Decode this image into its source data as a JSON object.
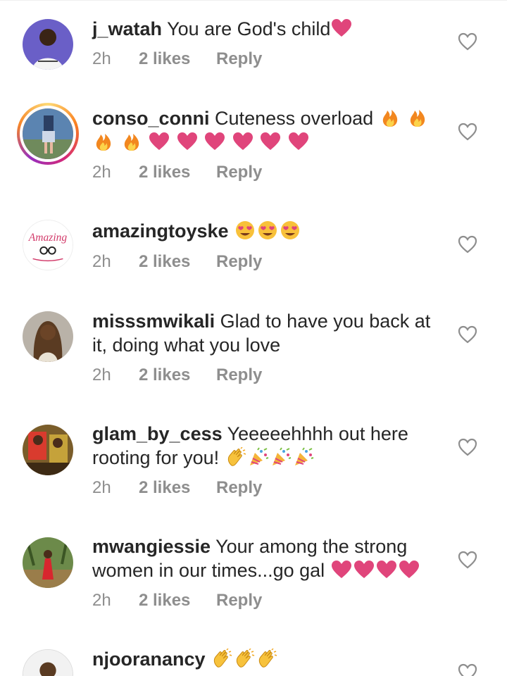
{
  "comments": [
    {
      "username": "j_watah",
      "lines": [
        "You are God's  child"
      ],
      "emoji_lines": [
        [
          "pink-heart"
        ]
      ],
      "time": "2h",
      "likes": "2 likes",
      "reply": "Reply"
    },
    {
      "username": "conso_conni",
      "lines": [
        "Cuteness overload"
      ],
      "emoji_lines": [
        [
          "fire",
          "fire"
        ],
        [
          "fire",
          "fire",
          "pink-heart",
          "pink-heart",
          "pink-heart",
          "pink-heart",
          "pink-heart",
          "pink-heart"
        ]
      ],
      "time": "2h",
      "likes": "2 likes",
      "reply": "Reply"
    },
    {
      "username": "amazingtoyske",
      "lines": [
        ""
      ],
      "emoji_lines": [
        [
          "heart-eyes",
          "heart-eyes",
          "heart-eyes"
        ]
      ],
      "time": "2h",
      "likes": "2 likes",
      "reply": "Reply",
      "avatar_text": "Amazing"
    },
    {
      "username": "misssmwikali",
      "lines": [
        "Glad to have you back at",
        "it, doing what you love"
      ],
      "time": "2h",
      "likes": "2 likes",
      "reply": "Reply"
    },
    {
      "username": "glam_by_cess",
      "lines": [
        "Yeeeeehhhh out here",
        "rooting for you!"
      ],
      "emoji_lines": [
        [],
        [
          "clap",
          "party",
          "party",
          "party"
        ]
      ],
      "time": "2h",
      "likes": "2 likes",
      "reply": "Reply"
    },
    {
      "username": "mwangiessie",
      "lines": [
        "Your among the strong",
        "women in our times...go gal"
      ],
      "emoji_lines": [
        [],
        [
          "pink-heart",
          "pink-heart",
          "pink-heart",
          "pink-heart"
        ]
      ],
      "time": "2h",
      "likes": "2 likes",
      "reply": "Reply"
    },
    {
      "username": "njooranancy",
      "lines": [
        ""
      ],
      "emoji_lines": [
        [
          "clap",
          "clap",
          "clap"
        ]
      ]
    }
  ],
  "colors": {
    "text": "#262626",
    "meta": "#8e8e8e",
    "heart_emoji": "#e0457b",
    "like_icon": "#8e8e8e"
  },
  "icons": {
    "like": "heart-outline-icon"
  }
}
